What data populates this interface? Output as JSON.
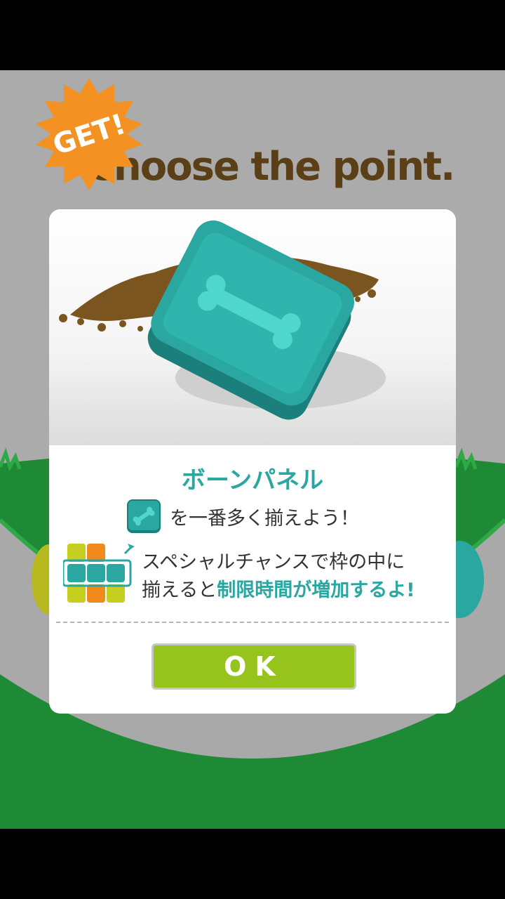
{
  "background": {
    "title": "Choose the point."
  },
  "badge": {
    "label": "GET!"
  },
  "modal": {
    "panel_name": "ボーンパネル",
    "line1": "を一番多く揃えよう！",
    "line2_a": "スペシャルチャンスで枠の中に",
    "line2_b": "揃えると",
    "line2_highlight": "制限時間が増加するよ!",
    "ok_label": "OK"
  },
  "colors": {
    "accent": "#2aa7a1",
    "ok_button": "#97c41c",
    "badge": "#f39122",
    "field_green": "#1f8a35",
    "title_brown": "#5a3f17"
  },
  "icons": [
    "bone-panel-icon",
    "panel-grid-icon",
    "arrow-icon",
    "get-badge-icon"
  ]
}
